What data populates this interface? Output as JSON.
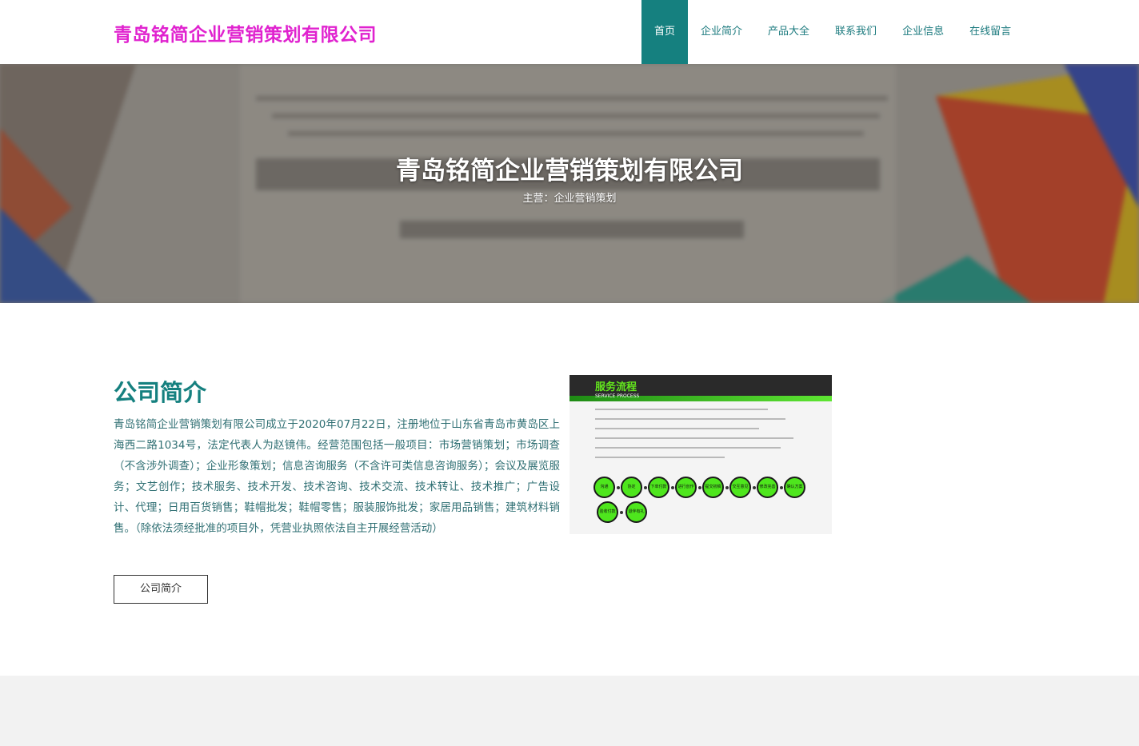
{
  "header": {
    "logo": "青岛铭简企业营销策划有限公司",
    "nav": [
      {
        "label": "首页",
        "active": true
      },
      {
        "label": "企业简介",
        "active": false
      },
      {
        "label": "产品大全",
        "active": false
      },
      {
        "label": "联系我们",
        "active": false
      },
      {
        "label": "企业信息",
        "active": false
      },
      {
        "label": "在线留言",
        "active": false
      }
    ]
  },
  "hero": {
    "title": "青岛铭简企业营销策划有限公司",
    "subtitle": "主营：企业营销策划"
  },
  "about": {
    "title": "公司简介",
    "text": "青岛铭简企业营销策划有限公司成立于2020年07月22日，注册地位于山东省青岛市黄岛区上海西二路1034号，法定代表人为赵镜伟。经营范围包括一般项目：市场营销策划；市场调查（不含涉外调查）；企业形象策划；信息咨询服务（不含许可类信息咨询服务）；会议及展览服务；文艺创作；技术服务、技术开发、技术咨询、技术交流、技术转让、技术推广；广告设计、代理；日用百货销售；鞋帽批发；鞋帽零售；服装服饰批发；家居用品销售；建筑材料销售。（除依法须经批准的项目外，凭营业执照依法自主开展经营活动）",
    "button": "公司简介",
    "image": {
      "title": "服务流程",
      "subtitle": "SERVICE PROCESS",
      "steps": [
        "沟通",
        "协定",
        "下单付款",
        "进行创作",
        "提交初稿",
        "交互意见",
        "修改完善",
        "确认方案",
        "验收付款",
        "退伴有礼"
      ]
    }
  },
  "colors": {
    "logo": "#e022cf",
    "accent": "#15807f",
    "text": "#2f6f73",
    "step_green": "#4ee61d"
  }
}
